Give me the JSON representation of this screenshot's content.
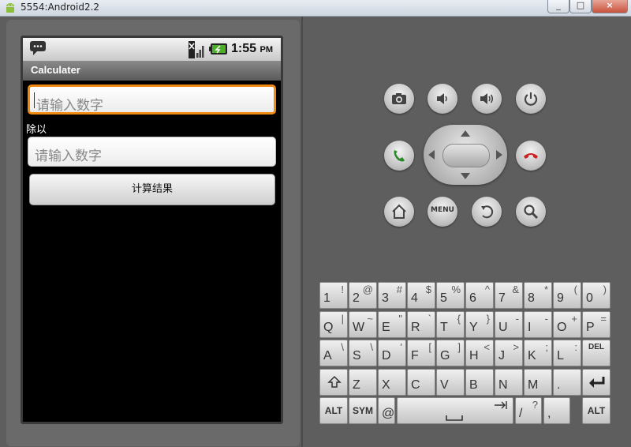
{
  "window": {
    "title": "5554:Android2.2"
  },
  "status_bar": {
    "time": "1:55",
    "ampm": "PM"
  },
  "app": {
    "title": "Calculater"
  },
  "form": {
    "input1_placeholder": "请输入数字",
    "operator_label": "除以",
    "input2_placeholder": "请输入数字",
    "calculate_label": "计算结果"
  },
  "controls": {
    "menu_label": "MENU"
  },
  "keyboard": {
    "row1": [
      [
        "1",
        "!"
      ],
      [
        "2",
        "@"
      ],
      [
        "3",
        "#"
      ],
      [
        "4",
        "$"
      ],
      [
        "5",
        "%"
      ],
      [
        "6",
        "^"
      ],
      [
        "7",
        "&"
      ],
      [
        "8",
        "*"
      ],
      [
        "9",
        "("
      ],
      [
        "0",
        ")"
      ]
    ],
    "row2": [
      [
        "Q",
        "|"
      ],
      [
        "W",
        "~"
      ],
      [
        "E",
        "\""
      ],
      [
        "R",
        "`"
      ],
      [
        "T",
        "{"
      ],
      [
        "Y",
        "}"
      ],
      [
        "U",
        "-"
      ],
      [
        "I",
        "-"
      ],
      [
        "O",
        "+"
      ],
      [
        "P",
        "="
      ]
    ],
    "row3": [
      [
        "A",
        "\\"
      ],
      [
        "S",
        "\\"
      ],
      [
        "D",
        "'"
      ],
      [
        "F",
        "["
      ],
      [
        "G",
        "]"
      ],
      [
        "H",
        "<"
      ],
      [
        "J",
        ">"
      ],
      [
        "K",
        ";"
      ],
      [
        "L",
        ":"
      ]
    ],
    "row4": [
      [
        "Z",
        ""
      ],
      [
        "X",
        ""
      ],
      [
        "C",
        ""
      ],
      [
        "V",
        ""
      ],
      [
        "B",
        ""
      ],
      [
        "N",
        ""
      ],
      [
        "M",
        ""
      ],
      [
        ".",
        ""
      ]
    ],
    "alt_label": "ALT",
    "sym_label": "SYM",
    "at_label": "@",
    "slash_key": [
      "/",
      "?"
    ],
    "comma_key": [
      ",",
      ""
    ],
    "del_label": "DEL"
  },
  "colors": {
    "focus_border": "#f08a13",
    "end_call": "#cc2222",
    "call": "#2a8a2a"
  }
}
